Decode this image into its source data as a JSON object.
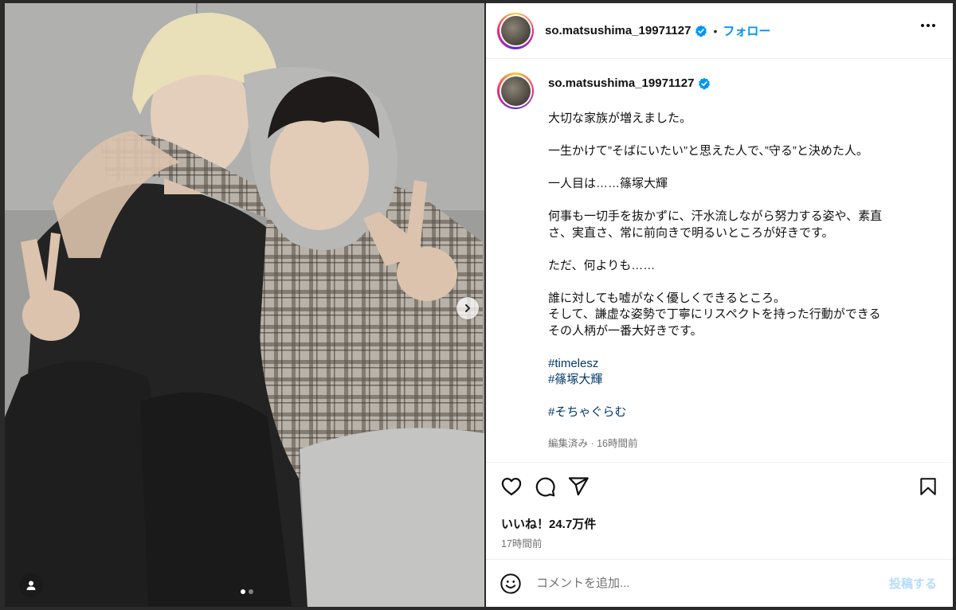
{
  "header": {
    "username": "so.matsushima_19971127",
    "separator": "•",
    "follow_label": "フォロー",
    "more_icon": "more-horizontal-icon"
  },
  "caption": {
    "username": "so.matsushima_19971127",
    "lines": [
      "大切な家族が増えました。",
      "",
      "一生かけて”そばにいたい”と思えた人で、”守る”と決めた人。",
      "",
      "一人目は……篠塚大輝",
      "",
      "何事も一切手を抜かずに、汗水流しながら努力する姿や、素直",
      "さ、実直さ、常に前向きで明るいところが好きです。",
      "",
      "ただ、何よりも……",
      "",
      "誰に対しても嘘がなく優しくできるところ。",
      "そして、謙虚な姿勢で丁寧にリスペクトを持った行動ができる",
      "その人柄が一番大好きです。",
      ""
    ],
    "hashtags": [
      "#timelesz",
      "#篠塚大輝",
      "",
      "#そちゃぐらむ"
    ],
    "meta": "編集済み · 16時間前"
  },
  "actions": {
    "icons": [
      "heart-icon",
      "comment-icon",
      "share-icon",
      "bookmark-icon"
    ],
    "likes": "いいね！24.7万件",
    "time": "17時間前"
  },
  "comment_box": {
    "placeholder": "コメントを追加...",
    "post_label": "投稿する"
  },
  "carousel": {
    "total": 2,
    "current": 1
  },
  "colors": {
    "accent": "#0095f6",
    "hashtag": "#00376b",
    "muted": "#737373",
    "post_disabled": "#b3dbff",
    "verified": "#0095f6"
  }
}
